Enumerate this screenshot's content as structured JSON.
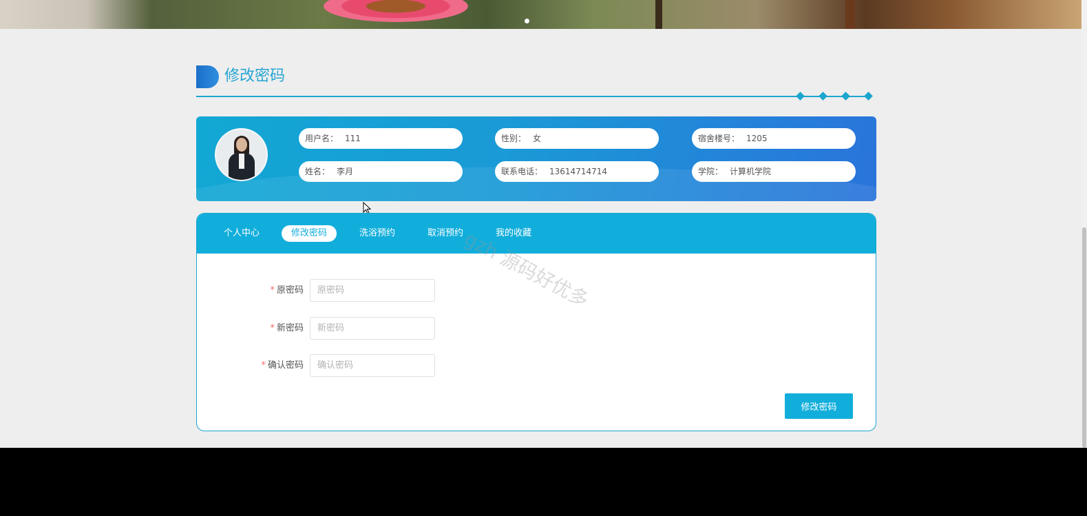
{
  "page_title": "修改密码",
  "user_info": {
    "username_label": "用户名：",
    "username_value": "111",
    "gender_label": "性别：",
    "gender_value": "女",
    "dorm_label": "宿舍楼号：",
    "dorm_value": "1205",
    "name_label": "姓名：",
    "name_value": "李月",
    "phone_label": "联系电话：",
    "phone_value": "13614714714",
    "college_label": "学院：",
    "college_value": "计算机学院"
  },
  "tabs": [
    {
      "label": "个人中心",
      "active": false
    },
    {
      "label": "修改密码",
      "active": true
    },
    {
      "label": "洗浴预约",
      "active": false
    },
    {
      "label": "取消预约",
      "active": false
    },
    {
      "label": "我的收藏",
      "active": false
    }
  ],
  "form": {
    "required_mark": "*",
    "old_password_label": "原密码",
    "old_password_placeholder": "原密码",
    "new_password_label": "新密码",
    "new_password_placeholder": "新密码",
    "confirm_password_label": "确认密码",
    "confirm_password_placeholder": "确认密码",
    "submit_label": "修改密码"
  },
  "watermark": "gzh 源码好优多",
  "colors": {
    "accent": "#12aedb",
    "title": "#27a5d2",
    "required": "#f56c6c",
    "background": "#eeeeee",
    "footer": "#000000"
  }
}
